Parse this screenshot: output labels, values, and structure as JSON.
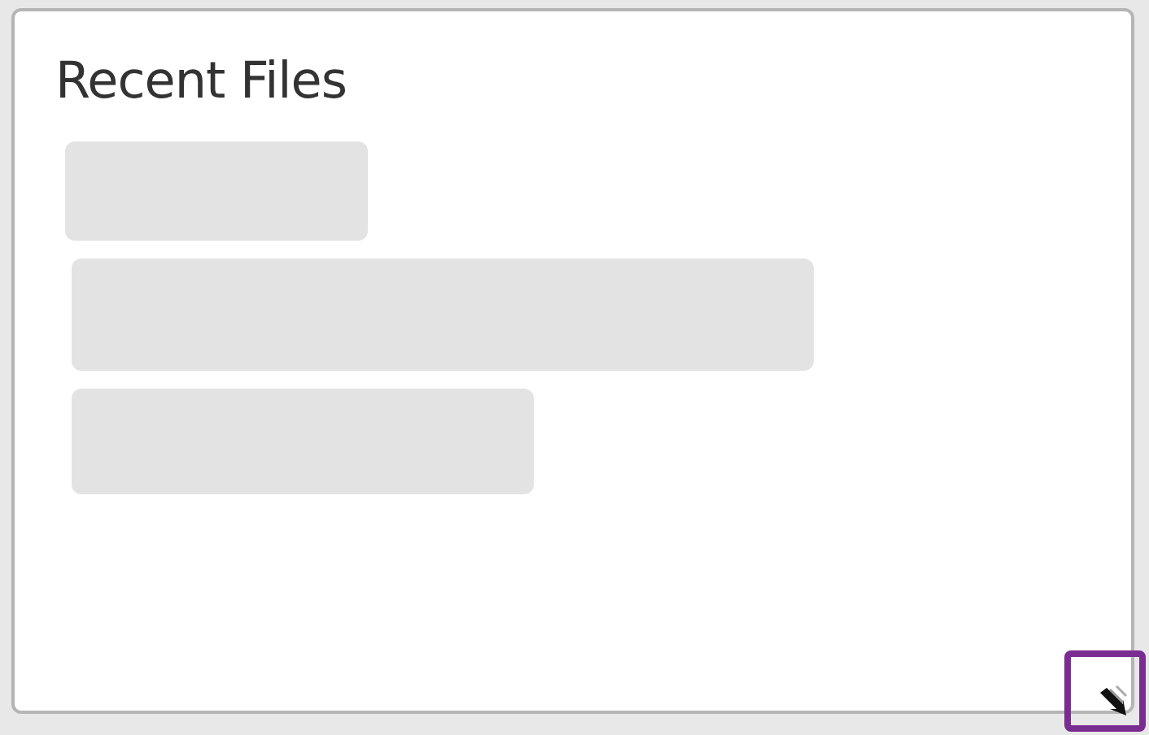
{
  "card": {
    "title": "Recent Files"
  },
  "resize_handle": {
    "highlighted": true
  }
}
